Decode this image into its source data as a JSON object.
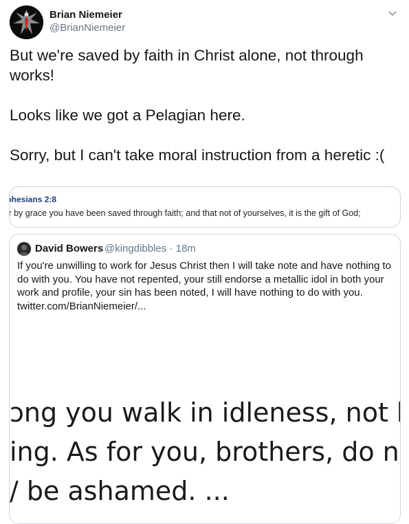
{
  "tweet": {
    "display_name": "Brian Niemeier",
    "handle": "@BrianNiemeier",
    "text": "But we're saved by faith in Christ alone, not through works!\n\nLooks like we got a Pelagian here.\n\nSorry, but I can't take moral instruction from a heretic :("
  },
  "verse_card": {
    "reference": "ɔhesians 2:8",
    "text": "ɪr by grace you have been saved through faith; and that not of yourselves, it is the gift of God;"
  },
  "quoted_tweet": {
    "display_name": "David Bowers",
    "handle": "@kingdibbles",
    "separator": "·",
    "time": "18m",
    "text": "If you're unwilling to work for Jesus Christ then I will take note and have nothing to do with you.  You have not repented, your still endorse a metallic idol in both your work and profile, your sin has been noted, I will have nothing to do with you.",
    "link": "twitter.com/BrianNiemeier/...",
    "image_lines": [
      "ɔng you walk in idleness, not b",
      "ing. As for you, brothers, do n",
      "/ be ashamed. ..."
    ]
  },
  "icons": [
    "avatar",
    "chevron-down-icon",
    "quoted-avatar"
  ]
}
